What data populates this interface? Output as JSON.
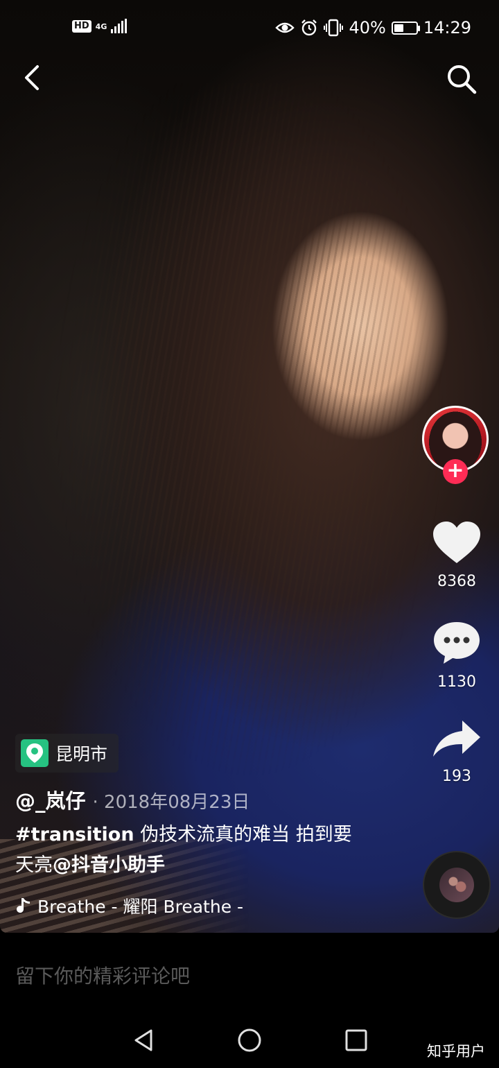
{
  "status_bar": {
    "hd": "HD",
    "network": "4G",
    "battery_percent_text": "40%",
    "battery_level": 0.4,
    "time": "14:29"
  },
  "nav": {
    "back_icon": "chevron-left-icon",
    "search_icon": "search-icon"
  },
  "actions": {
    "likes": "8368",
    "comments": "1130",
    "shares": "193"
  },
  "location": {
    "label": "昆明市",
    "icon": "map-pin-icon",
    "icon_color": "#26c281"
  },
  "post": {
    "author": "@_岚仔",
    "date": "· 2018年08月23日",
    "caption_hashtag": "#transition",
    "caption_text_1": " 伪技术流真的难当  拍到要",
    "caption_text_2": "天亮",
    "caption_mention": "@抖音小助手"
  },
  "music": {
    "text": "Breathe - 耀阳    Breathe -"
  },
  "comment": {
    "placeholder": "留下你的精彩评论吧"
  },
  "watermark": "知乎用户",
  "colors": {
    "follow_button": "#fe2c55",
    "avatar_bg": "#e8383c"
  }
}
